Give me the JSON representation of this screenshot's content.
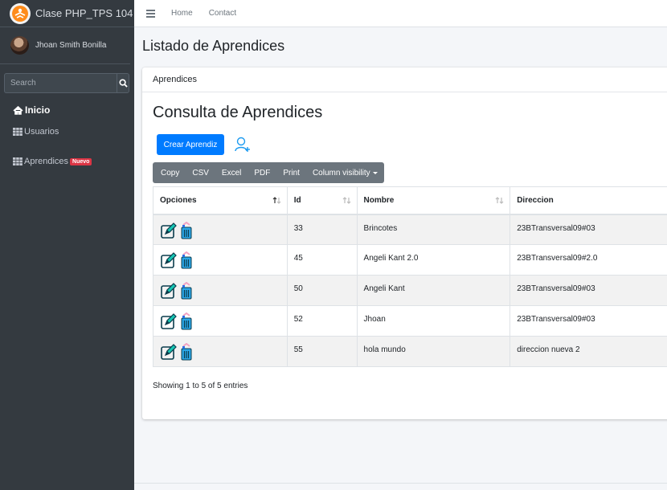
{
  "brand": {
    "title": "Clase PHP_TPS 104",
    "logo_icon": "logo-icon"
  },
  "user": {
    "name": "Jhoan Smith Bonilla"
  },
  "search": {
    "placeholder": "Search"
  },
  "sidebar": {
    "items": [
      {
        "label": "Inicio",
        "icon": "home-icon"
      },
      {
        "label": "Usuarios",
        "icon": "grid-icon"
      },
      {
        "label": "Aprendices",
        "icon": "grid-icon",
        "badge": "Nuevo"
      }
    ]
  },
  "topbar": {
    "links": [
      "Home",
      "Contact"
    ]
  },
  "page": {
    "title": "Listado de Aprendices"
  },
  "card": {
    "header": "Aprendices",
    "title": "Consulta de Aprendices",
    "create_button": "Crear Aprendiz"
  },
  "toolbar": {
    "buttons": [
      "Copy",
      "CSV",
      "Excel",
      "PDF",
      "Print",
      "Column visibility"
    ]
  },
  "table": {
    "columns": [
      "Opciones",
      "Id",
      "Nombre",
      "Direccion"
    ],
    "rows": [
      {
        "id": "33",
        "nombre": "Brincotes",
        "direccion": "23BTransversal09#03"
      },
      {
        "id": "45",
        "nombre": "Angeli Kant 2.0",
        "direccion": "23BTransversal09#2.0"
      },
      {
        "id": "50",
        "nombre": "Angeli Kant",
        "direccion": "23BTransversal09#03"
      },
      {
        "id": "52",
        "nombre": "Jhoan",
        "direccion": "23BTransversal09#03"
      },
      {
        "id": "55",
        "nombre": "hola mundo",
        "direccion": "direccion nueva 2"
      }
    ]
  },
  "info": "Showing 1 to 5 of 5 entries",
  "colors": {
    "primary": "#007bff",
    "sidebar": "#343a40",
    "danger": "#dc3545",
    "secondary": "#6c757d"
  }
}
